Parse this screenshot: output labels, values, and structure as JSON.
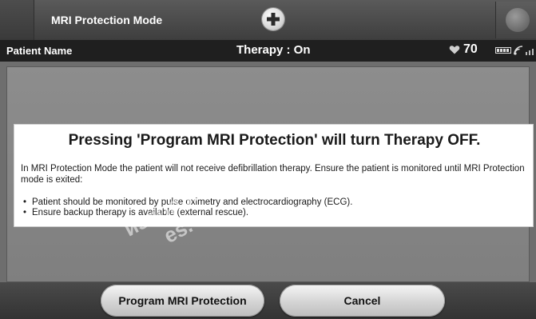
{
  "header": {
    "mode_title": "MRI Protection Mode"
  },
  "status": {
    "patient_label": "Patient Name",
    "therapy": "Therapy : On",
    "heart_rate": "70"
  },
  "dialog": {
    "title": "Pressing 'Program MRI Protection' will turn Therapy OFF.",
    "body": "In MRI Protection Mode the patient will not receive defibrillation therapy. Ensure the patient is monitored until MRI Protection mode is exited:",
    "items": [
      "Patient should be monitored by pulse oximetry and electrocardiography (ECG).",
      "Ensure backup therapy is available (external rescue)."
    ],
    "bullet": "•"
  },
  "buttons": {
    "program": "Program MRI Protection",
    "cancel": "Cancel"
  },
  "watermark": {
    "line1": "изпол3ва.",
    "line2": "es."
  },
  "icons": {
    "plus": "plus-circle-icon",
    "heart": "heart-icon",
    "battery": "battery-icon",
    "wifi": "wireless-icon",
    "signal": "signal-bars-icon"
  }
}
